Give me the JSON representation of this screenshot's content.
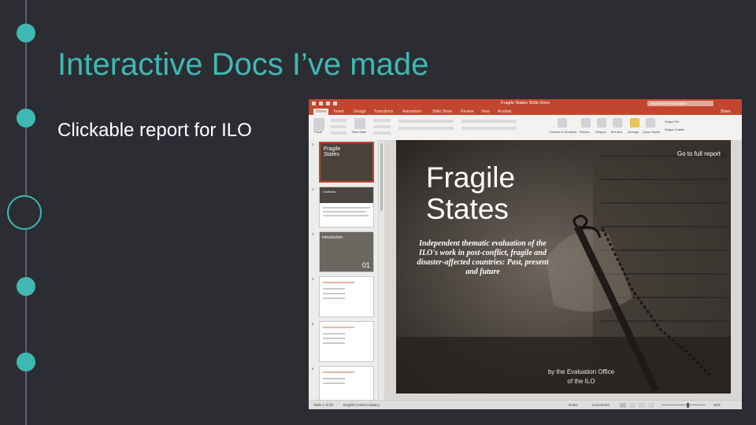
{
  "slide": {
    "title": "Interactive Docs I’ve made",
    "subtitle": "Clickable report for ILO"
  },
  "colors": {
    "accent": "#3fb8b3",
    "background": "#2b2d33",
    "powerpoint_red": "#c2462f"
  },
  "app": {
    "window_title": "Fragile States Slide Docs",
    "search_placeholder": "Search in Presentation",
    "share_label": "Share",
    "tabs": [
      "Home",
      "Insert",
      "Design",
      "Transitions",
      "Animations",
      "Slide Show",
      "Review",
      "View",
      "Acrobat"
    ],
    "active_tab": "Home",
    "toolbar": {
      "paste": "Paste",
      "new_slide": "New Slide",
      "convert_smartart": "Convert to SmartArt",
      "picture": "Picture",
      "shapes": "Shapes",
      "text_box": "Text Box",
      "arrange": "Arrange",
      "quick_styles": "Quick Styles",
      "shape_fill": "Shape Fill",
      "shape_outline": "Shape Outline"
    },
    "thumbnails": [
      {
        "num": "1",
        "title": "Fragile States"
      },
      {
        "num": "2",
        "title": "Contents"
      },
      {
        "num": "3",
        "title": "Introduction",
        "badge": "01"
      },
      {
        "num": "4"
      },
      {
        "num": "5"
      },
      {
        "num": "6"
      }
    ],
    "slide_main": {
      "title_line1": "Fragile",
      "title_line2": "States",
      "description": "Independent thematic evaluation of the ILO's work in post-conflict, fragile and disaster-affected countries: Past, present and future",
      "link": "Go to full report",
      "by_line1": "by the Evaluation Office",
      "by_line2": "of the ILO"
    },
    "status": {
      "slide_counter": "Slide 1 of 20",
      "language": "English (United States)",
      "notes": "Notes",
      "comments": "Comments",
      "zoom": "66%"
    }
  }
}
